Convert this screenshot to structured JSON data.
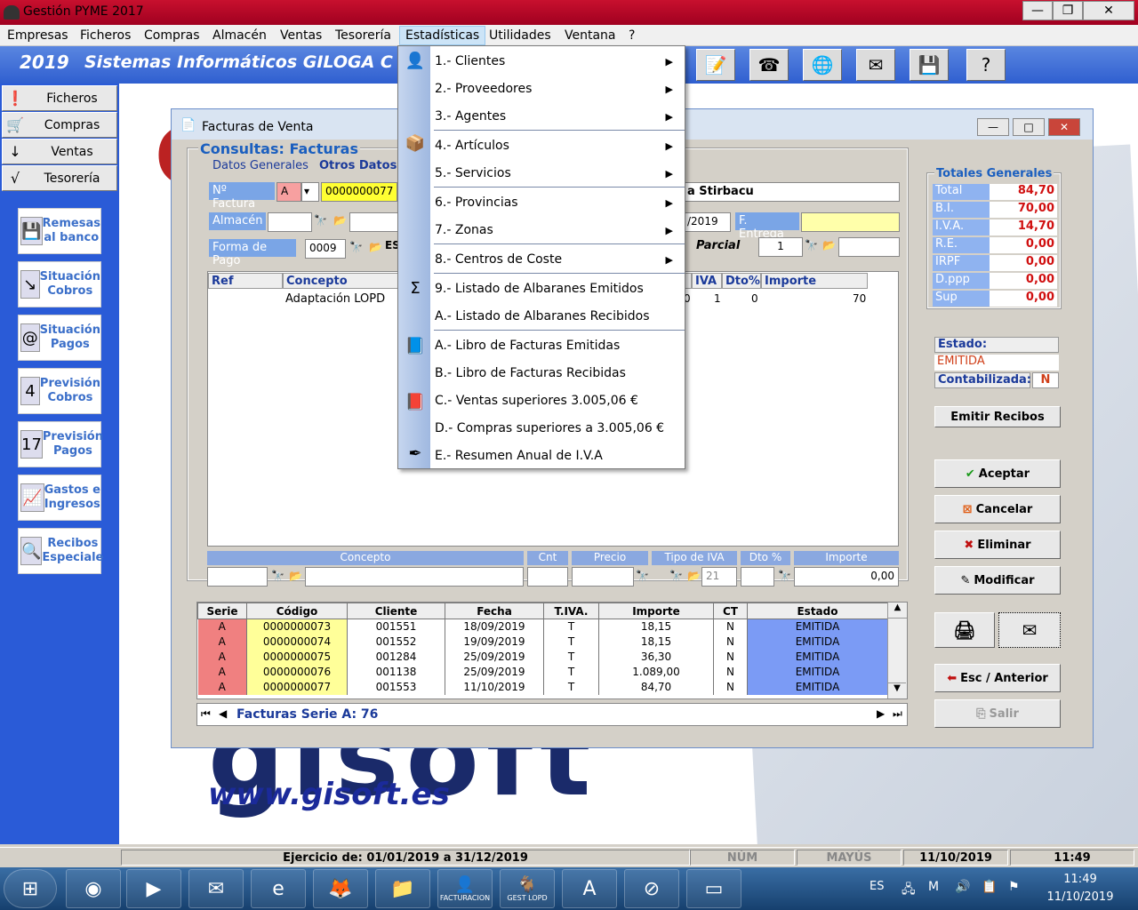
{
  "app": {
    "title": "Gestión PYME 2017"
  },
  "menu": [
    "Empresas",
    "Ficheros",
    "Compras",
    "Almacén",
    "Ventas",
    "Tesorería",
    "Estadísticas",
    "Utilidades",
    "Ventana",
    "?"
  ],
  "banner": {
    "year": "2019",
    "company": "Sistemas Informáticos GILOGA C"
  },
  "toolbar_icons": [
    "notes-icon",
    "phone-icon",
    "globe-icon",
    "mail-icon",
    "save-icon",
    "help-icon"
  ],
  "nav_top": [
    {
      "label": "Ficheros",
      "icon": "exclamation-icon"
    },
    {
      "label": "Compras",
      "icon": "cart-icon"
    },
    {
      "label": "Ventas",
      "icon": "sale-icon"
    },
    {
      "label": "Tesorería",
      "icon": "money-icon"
    }
  ],
  "nav_big": [
    {
      "label": "Remesas\nal banco"
    },
    {
      "label": "Situación\nCobros"
    },
    {
      "label": "Situación\nPagos"
    },
    {
      "label": "Previsión\nCobros"
    },
    {
      "label": "Previsión\nPagos"
    },
    {
      "label": "Gastos e\nIngresos"
    },
    {
      "label": "Recibos\nEspeciale"
    }
  ],
  "desktop": {
    "logo": "gisoft",
    "url": "www.gisoft.es",
    "big": "G"
  },
  "window": {
    "title": "Facturas de Venta",
    "group": "Consultas: Facturas",
    "tabs": [
      "Datos Generales",
      "Otros Datos"
    ],
    "labels": {
      "nfactura": "Nº Factura",
      "almacen": "Almacén",
      "forma_pago": "Forma de Pago",
      "fentrega": "F. Entrega",
      "parcial": "Parcial"
    },
    "values": {
      "serie": "A",
      "numero": "0000000077",
      "forma_pago": "0009",
      "es": "ES",
      "cliente_nombre": "a Stirbacu",
      "fecha": "/2019",
      "parcial": "1"
    },
    "lines_header": {
      "ref": "Ref",
      "concepto": "Concepto",
      "iva": "IVA",
      "dto": "Dto%",
      "importe": "Importe"
    },
    "line": {
      "concepto": "Adaptación LOPD",
      "c0": "0",
      "iva": "1",
      "dto": "0",
      "importe": "70"
    },
    "edit_headers": [
      "Concepto",
      "Cnt",
      "Precio",
      "Tipo de IVA",
      "Dto %",
      "Importe"
    ],
    "edit_values": {
      "tipo_iva": "21",
      "importe": "0,00"
    },
    "totals": {
      "title": "Totales Generales",
      "rows": [
        {
          "label": "Total",
          "value": "84,70"
        },
        {
          "label": "B.I.",
          "value": "70,00"
        },
        {
          "label": "I.V.A.",
          "value": "14,70"
        },
        {
          "label": "R.E.",
          "value": "0,00"
        },
        {
          "label": "IRPF",
          "value": "0,00"
        },
        {
          "label": "D.ppp",
          "value": "0,00"
        },
        {
          "label": "Sup",
          "value": "0,00"
        }
      ]
    },
    "estado": {
      "label": "Estado:",
      "value": "EMITIDA",
      "contab_label": "Contabilizada:",
      "contab_value": "N"
    },
    "buttons": {
      "emitir": "Emitir Recibos",
      "aceptar": "Aceptar",
      "cancelar": "Cancelar",
      "eliminar": "Eliminar",
      "modificar": "Modificar",
      "esc": "Esc / Anterior",
      "salir": "Salir"
    },
    "table": {
      "headers": [
        "Serie",
        "Código",
        "Cliente",
        "Fecha",
        "T.IVA.",
        "Importe",
        "CT",
        "Estado"
      ],
      "rows": [
        [
          "A",
          "0000000073",
          "001551",
          "18/09/2019",
          "T",
          "18,15",
          "N",
          "EMITIDA"
        ],
        [
          "A",
          "0000000074",
          "001552",
          "19/09/2019",
          "T",
          "18,15",
          "N",
          "EMITIDA"
        ],
        [
          "A",
          "0000000075",
          "001284",
          "25/09/2019",
          "T",
          "36,30",
          "N",
          "EMITIDA"
        ],
        [
          "A",
          "0000000076",
          "001138",
          "25/09/2019",
          "T",
          "1.089,00",
          "N",
          "EMITIDA"
        ],
        [
          "A",
          "0000000077",
          "001553",
          "11/10/2019",
          "T",
          "84,70",
          "N",
          "EMITIDA"
        ]
      ]
    },
    "nav_label": "Facturas Serie A: 76"
  },
  "dropdown": {
    "items": [
      {
        "label": "1.- Clientes",
        "arrow": true
      },
      {
        "label": "2.- Proveedores",
        "arrow": true
      },
      {
        "label": "3.- Agentes",
        "arrow": true
      },
      {
        "label": "4.- Artículos",
        "arrow": true
      },
      {
        "label": "5.- Servicios",
        "arrow": true
      },
      {
        "label": "6.- Provincias",
        "arrow": true
      },
      {
        "label": "7.- Zonas",
        "arrow": true
      },
      {
        "label": "8.- Centros de Coste",
        "arrow": true
      },
      {
        "label": "9.- Listado de Albaranes Emitidos",
        "arrow": false
      },
      {
        "label": "A.- Listado de Albaranes Recibidos",
        "arrow": false
      },
      {
        "label": "A.- Libro de Facturas Emitidas",
        "arrow": false
      },
      {
        "label": "B.- Libro de Facturas Recibidas",
        "arrow": false
      },
      {
        "label": "C.- Ventas superiores 3.005,06 €",
        "arrow": false
      },
      {
        "label": "D.- Compras superiores a 3.005,06 €",
        "arrow": false
      },
      {
        "label": "E.- Resumen Anual de I.V.A",
        "arrow": false
      }
    ]
  },
  "status": {
    "ejercicio": "Ejercicio de: 01/01/2019 a 31/12/2019",
    "num": "NÚM",
    "mayus": "MAYÚS",
    "date": "11/10/2019",
    "time": "11:49"
  },
  "taskbar": {
    "lang": "ES",
    "time": "11:49",
    "date": "11/10/2019",
    "apps": [
      "FACTURACION",
      "GEST LOPD"
    ]
  }
}
